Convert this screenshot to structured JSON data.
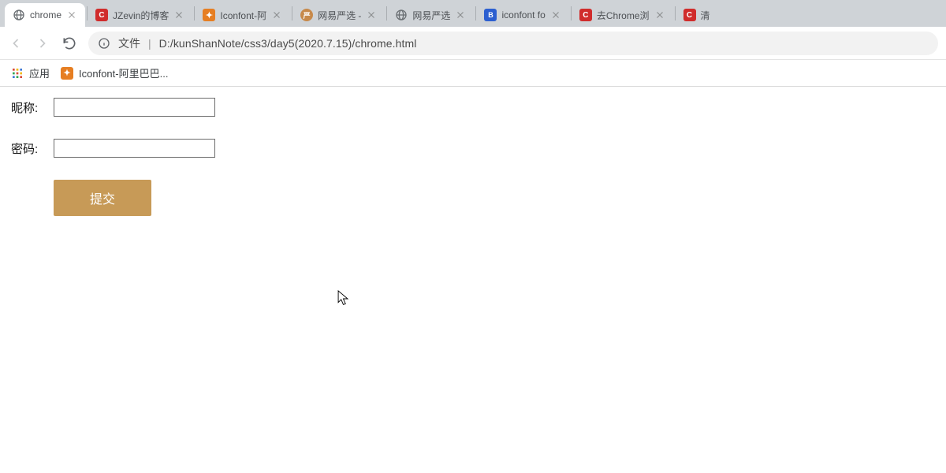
{
  "tabs": [
    {
      "title": "chrome",
      "icon": "globe",
      "active": true
    },
    {
      "title": "JZevin的博客",
      "icon": "red-c",
      "active": false
    },
    {
      "title": "Iconfont-阿",
      "icon": "orange",
      "active": false
    },
    {
      "title": "网易严选 - ",
      "icon": "wy",
      "active": false
    },
    {
      "title": "网易严选",
      "icon": "globe",
      "active": false
    },
    {
      "title": "iconfont fo",
      "icon": "baidu",
      "active": false
    },
    {
      "title": "去Chrome浏",
      "icon": "red-c",
      "active": false
    },
    {
      "title": "清",
      "icon": "red-c",
      "active": false
    }
  ],
  "addressbar": {
    "file_label": "文件",
    "url": "D:/kunShanNote/css3/day5(2020.7.15)/chrome.html"
  },
  "bookmarks": {
    "apps_label": "应用",
    "item1_label": "Iconfont-阿里巴巴..."
  },
  "form": {
    "nickname_label": "昵称:",
    "password_label": "密码:",
    "submit_label": "提交",
    "nickname_value": "",
    "password_value": ""
  }
}
